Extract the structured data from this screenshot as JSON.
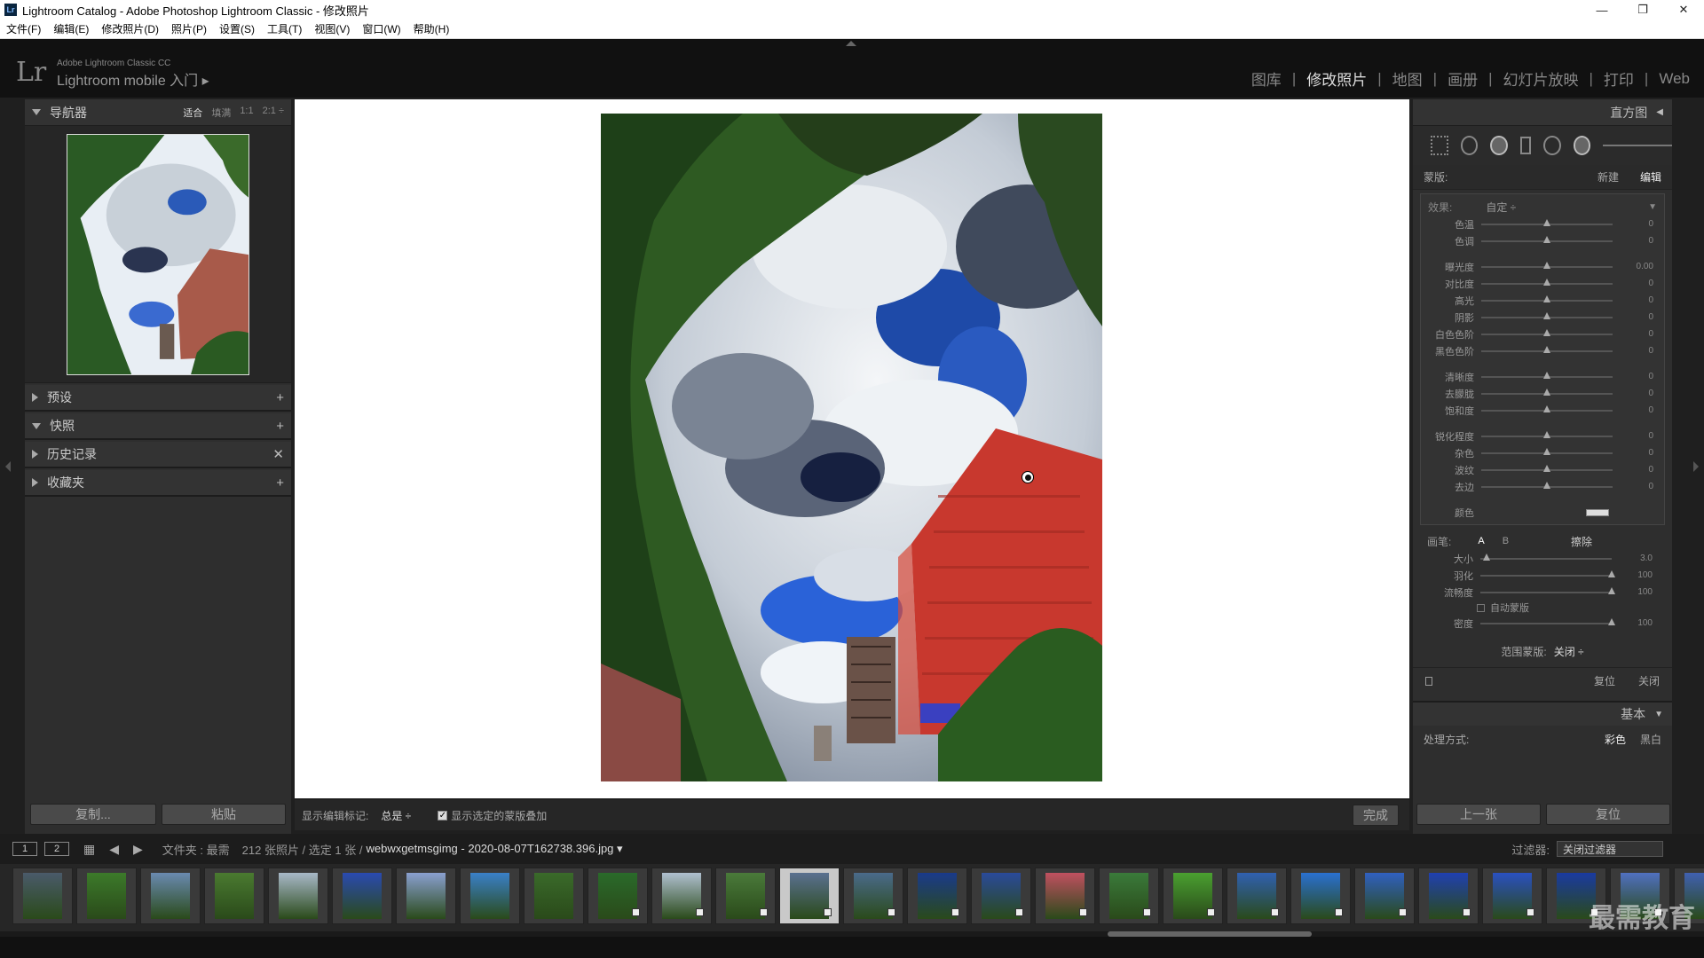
{
  "window": {
    "title": "Lightroom Catalog - Adobe Photoshop Lightroom Classic - 修改照片",
    "app_icon": "Lr",
    "controls": [
      "—",
      "❐",
      "✕"
    ]
  },
  "menu": [
    "文件(F)",
    "编辑(E)",
    "修改照片(D)",
    "照片(P)",
    "设置(S)",
    "工具(T)",
    "视图(V)",
    "窗口(W)",
    "帮助(H)"
  ],
  "identity": {
    "logo": "Lr",
    "line1": "Adobe Lightroom Classic CC",
    "line2": "Lightroom mobile 入门 ▸"
  },
  "modules": [
    {
      "label": "图库",
      "active": false
    },
    {
      "label": "修改照片",
      "active": true
    },
    {
      "label": "地图",
      "active": false
    },
    {
      "label": "画册",
      "active": false
    },
    {
      "label": "幻灯片放映",
      "active": false
    },
    {
      "label": "打印",
      "active": false
    },
    {
      "label": "Web",
      "active": false
    }
  ],
  "left": {
    "navigator": {
      "title": "导航器",
      "zoom_options": [
        "适合",
        "填满",
        "1:1",
        "2:1 ÷"
      ]
    },
    "panels": [
      {
        "title": "预设",
        "action": "+",
        "open": false
      },
      {
        "title": "快照",
        "action": "+",
        "open": true
      },
      {
        "title": "历史记录",
        "action": "✕",
        "open": false
      },
      {
        "title": "收藏夹",
        "action": "+",
        "open": false
      }
    ],
    "copy_label": "复制...",
    "paste_label": "粘贴"
  },
  "toolbar": {
    "label": "显示编辑标记:",
    "value": "总是 ÷",
    "checkbox_label": "显示选定的蒙版叠加",
    "checkbox_mark": "✓",
    "done_label": "完成"
  },
  "right": {
    "histogram_title": "直方图",
    "mask": {
      "label": "蒙版:",
      "new": "新建",
      "edit": "编辑"
    },
    "effect": {
      "label": "效果:",
      "preset": "自定 ÷"
    },
    "slider_groups": [
      [
        {
          "label": "色温",
          "value": "0",
          "pos": 0.5
        },
        {
          "label": "色调",
          "value": "0",
          "pos": 0.5
        }
      ],
      [
        {
          "label": "曝光度",
          "value": "0.00",
          "pos": 0.5
        },
        {
          "label": "对比度",
          "value": "0",
          "pos": 0.5
        },
        {
          "label": "高光",
          "value": "0",
          "pos": 0.5
        },
        {
          "label": "阴影",
          "value": "0",
          "pos": 0.5
        },
        {
          "label": "白色色阶",
          "value": "0",
          "pos": 0.5
        },
        {
          "label": "黑色色阶",
          "value": "0",
          "pos": 0.5
        }
      ],
      [
        {
          "label": "清晰度",
          "value": "0",
          "pos": 0.5
        },
        {
          "label": "去朦胧",
          "value": "0",
          "pos": 0.5
        },
        {
          "label": "饱和度",
          "value": "0",
          "pos": 0.5
        }
      ],
      [
        {
          "label": "锐化程度",
          "value": "0",
          "pos": 0.5
        },
        {
          "label": "杂色",
          "value": "0",
          "pos": 0.5
        },
        {
          "label": "波纹",
          "value": "0",
          "pos": 0.5
        },
        {
          "label": "去边",
          "value": "0",
          "pos": 0.5
        }
      ]
    ],
    "color_label": "颜色",
    "brush": {
      "label": "画笔:",
      "a": "A",
      "b": "B",
      "erase": "擦除"
    },
    "brush_sliders": [
      {
        "label": "大小",
        "value": "3.0",
        "pos": 0.05
      },
      {
        "label": "羽化",
        "value": "100",
        "pos": 1.0
      },
      {
        "label": "流畅度",
        "value": "100",
        "pos": 1.0
      }
    ],
    "auto_mask_label": "自动蒙版",
    "density": {
      "label": "密度",
      "value": "100",
      "pos": 1.0
    },
    "range_mask": {
      "label": "范围蒙版:",
      "value": "关闭 ÷"
    },
    "reset_label": "复位",
    "close_label": "关闭",
    "basic_title": "基本",
    "process": {
      "label": "处理方式:",
      "color": "彩色",
      "bw": "黑白"
    },
    "prev_label": "上一张",
    "reset2_label": "复位"
  },
  "filmbar": {
    "pages": [
      "1",
      "2"
    ],
    "folder": "文件夹 : 最需",
    "count": "212 张照片 / 选定 1 张 /",
    "filename": "webwxgetmsgimg - 2020-08-07T162738.396.jpg ▾",
    "filter_label": "过滤器:",
    "filter_value": "关闭过滤器"
  },
  "filmstrip_colors": [
    "#4a5a6a",
    "#3c7a2a",
    "#6a8ab0",
    "#4a7a30",
    "#a8b8c8",
    "#2a4ab0",
    "#8aa0d0",
    "#3a80c8",
    "#3a6a2a",
    "#2a6a2a",
    "#b0c0d0",
    "#4a7a3a",
    "#5a7090",
    "#4a6a8a",
    "#1a3a8a",
    "#2a4a9a",
    "#c05060",
    "#3a7a3a",
    "#4aa030",
    "#3060b0",
    "#2a70d0",
    "#3060c0",
    "#2040b0",
    "#2a50c0",
    "#1a3aa0",
    "#5070c0",
    "#4060b0"
  ],
  "watermark": "最需教育"
}
